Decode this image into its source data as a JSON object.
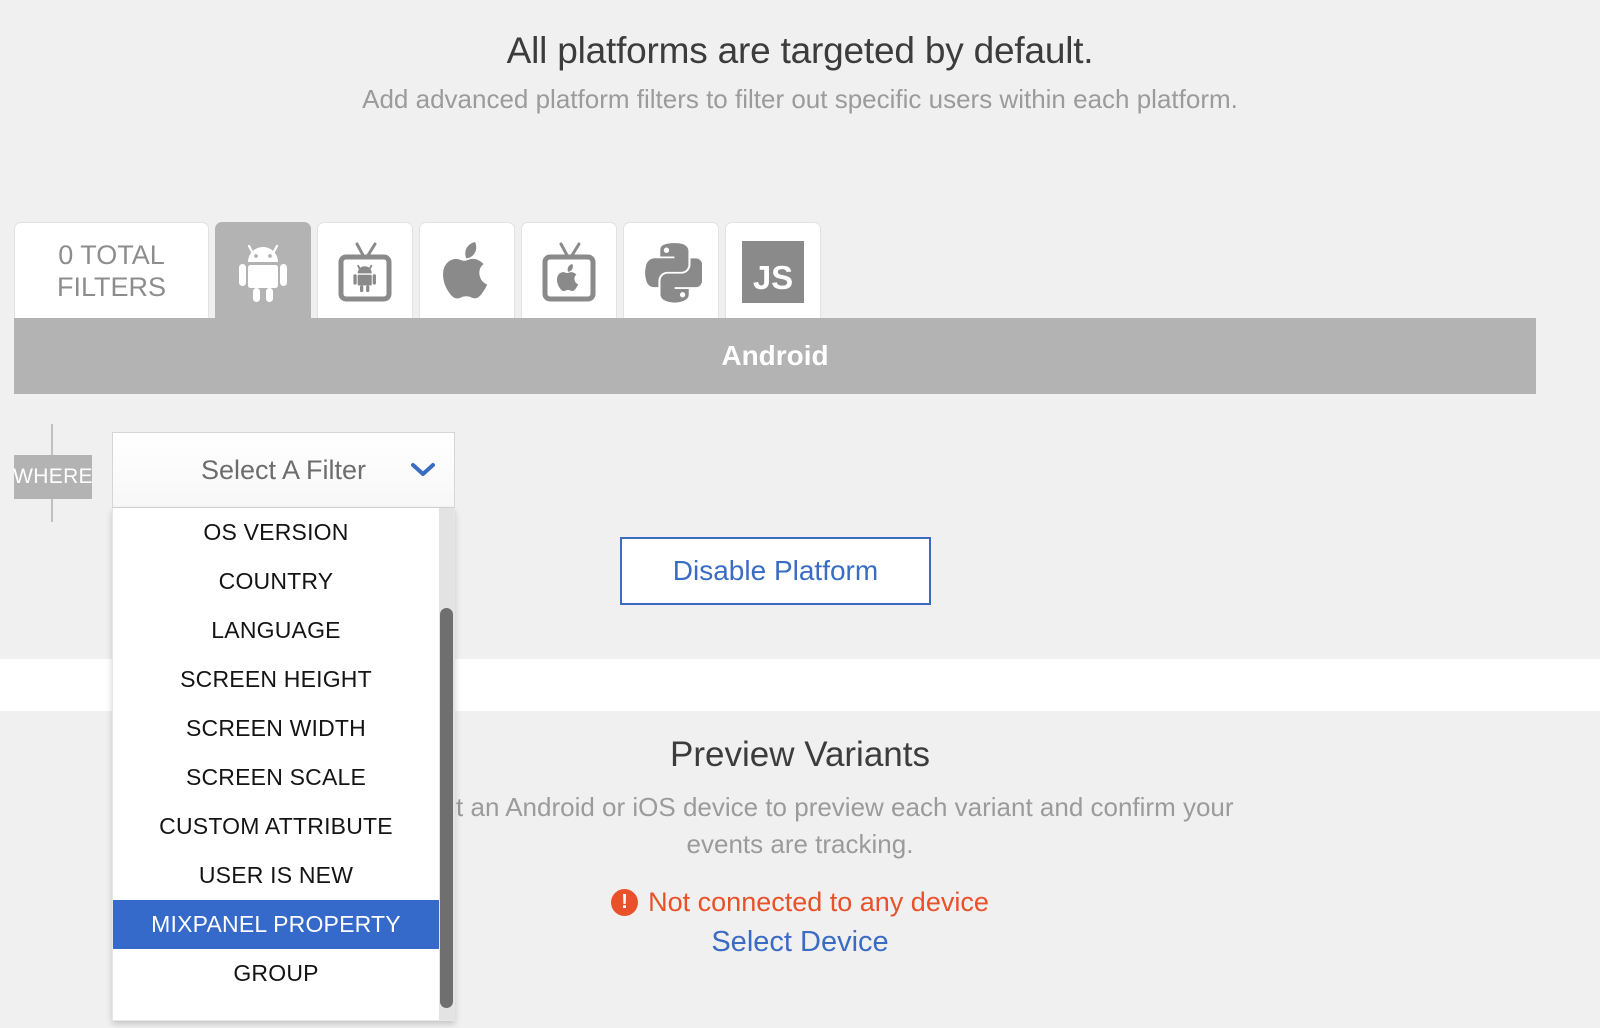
{
  "header": {
    "title": "All platforms are targeted by default.",
    "subtitle": "Add advanced platform filters to filter out specific users within each platform."
  },
  "tabs": {
    "filters_label": "0 TOTAL\nFILTERS",
    "items": [
      {
        "id": "android",
        "icon": "android-icon",
        "label": "Android",
        "active": true
      },
      {
        "id": "android-tv",
        "icon": "android-tv-icon",
        "label": "Android TV",
        "active": false
      },
      {
        "id": "apple",
        "icon": "apple-icon",
        "label": "iOS",
        "active": false
      },
      {
        "id": "apple-tv",
        "icon": "apple-tv-icon",
        "label": "Apple TV",
        "active": false
      },
      {
        "id": "python",
        "icon": "python-icon",
        "label": "Python",
        "active": false
      },
      {
        "id": "javascript",
        "icon": "js-icon",
        "label": "JS",
        "active": false
      }
    ]
  },
  "platform_banner": {
    "label": "Android",
    "background_color": "#b3b3b3"
  },
  "filter_row": {
    "where_label": "WHERE",
    "select": {
      "value": "Select A Filter",
      "chevron_icon": "chevron-down-icon",
      "chevron_color": "#3a6cc4",
      "open": true
    },
    "options": [
      {
        "label": "OS VERSION",
        "selected": false
      },
      {
        "label": "COUNTRY",
        "selected": false
      },
      {
        "label": "LANGUAGE",
        "selected": false
      },
      {
        "label": "SCREEN HEIGHT",
        "selected": false
      },
      {
        "label": "SCREEN WIDTH",
        "selected": false
      },
      {
        "label": "SCREEN SCALE",
        "selected": false
      },
      {
        "label": "CUSTOM ATTRIBUTE",
        "selected": false
      },
      {
        "label": "USER IS NEW",
        "selected": false
      },
      {
        "label": "MIXPANEL PROPERTY",
        "selected": true
      },
      {
        "label": "GROUP",
        "selected": false
      }
    ],
    "highlight_color": "#3569ca"
  },
  "disable_platform": {
    "label": "Disable Platform",
    "accent_color": "#3a6cc4"
  },
  "preview": {
    "title": "Preview Variants",
    "subtitle": "Connect an Android or iOS device to preview each variant and confirm your events are tracking.",
    "status_text": "Not connected to any device",
    "status_icon": "alert-circle-icon",
    "status_color": "#e8512a",
    "select_device_label": "Select Device",
    "link_color": "#3a6cc4"
  }
}
